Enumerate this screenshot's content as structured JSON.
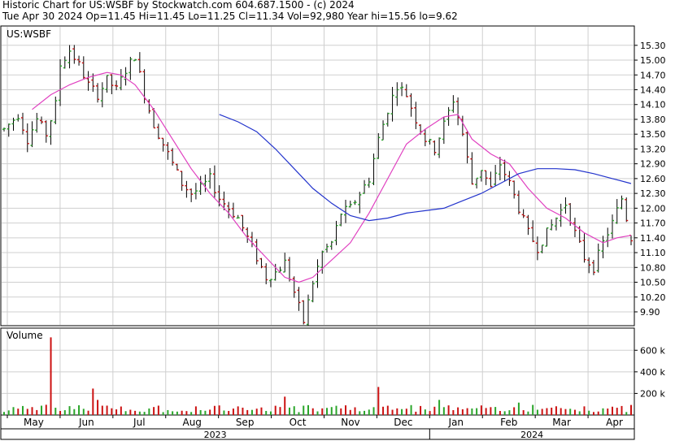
{
  "header": {
    "line1": "Historic Chart for US:WSBF by Stockwatch.com 604.687.1500 - (c) 2024",
    "line2": "Tue Apr 30 2024   Op=11.45   Hi=11.45   Lo=11.25   Cl=11.34   Vol=92,980   Year hi=15.56   lo=9.62"
  },
  "chart_data": {
    "type": "ohlc",
    "symbol_label": "US:WSBF",
    "volume_label": "Volume",
    "price_ticks": [
      15.3,
      15.0,
      14.7,
      14.4,
      14.1,
      13.8,
      13.5,
      13.2,
      12.9,
      12.6,
      12.3,
      12.0,
      11.7,
      11.4,
      11.1,
      10.8,
      10.5,
      10.2,
      9.9
    ],
    "price_tick_labels": [
      "15.30",
      "15.00",
      "14.70",
      "14.40",
      "14.10",
      "13.80",
      "13.50",
      "13.20",
      "12.90",
      "12.60",
      "12.30",
      "12.00",
      "11.70",
      "11.40",
      "11.10",
      "10.80",
      "10.50",
      "10.20",
      "9.90"
    ],
    "price_range": [
      9.62,
      15.56
    ],
    "volume_ticks": [
      200000,
      400000,
      600000
    ],
    "volume_tick_labels": [
      "200 k",
      "400 k",
      "600 k"
    ],
    "volume_range": [
      0,
      760000
    ],
    "months": [
      "May",
      "Jun",
      "Jul",
      "Aug",
      "Sep",
      "Oct",
      "Nov",
      "Dec",
      "Jan",
      "Feb",
      "Mar",
      "Apr"
    ],
    "years": [
      "2023",
      "2024"
    ],
    "last_bar": {
      "open": 11.45,
      "high": 11.45,
      "low": 11.25,
      "close": 11.34,
      "volume": 92980
    },
    "price_path": [
      [
        0,
        13.6
      ],
      [
        3,
        13.9
      ],
      [
        5,
        13.4
      ],
      [
        7,
        13.8
      ],
      [
        9,
        13.5
      ],
      [
        11,
        14.1
      ],
      [
        12,
        14.9
      ],
      [
        14,
        15.2
      ],
      [
        16,
        14.9
      ],
      [
        18,
        14.5
      ],
      [
        20,
        14.3
      ],
      [
        22,
        14.6
      ],
      [
        24,
        14.4
      ],
      [
        26,
        14.8
      ],
      [
        28,
        15.1
      ],
      [
        30,
        14.3
      ],
      [
        32,
        13.7
      ],
      [
        34,
        13.3
      ],
      [
        36,
        12.9
      ],
      [
        38,
        12.5
      ],
      [
        40,
        12.3
      ],
      [
        42,
        12.4
      ],
      [
        44,
        12.6
      ],
      [
        46,
        12.2
      ],
      [
        48,
        12.0
      ],
      [
        50,
        11.8
      ],
      [
        52,
        11.4
      ],
      [
        54,
        11.0
      ],
      [
        56,
        10.6
      ],
      [
        58,
        10.7
      ],
      [
        60,
        10.9
      ],
      [
        62,
        10.3
      ],
      [
        64,
        9.7
      ],
      [
        66,
        10.5
      ],
      [
        68,
        11.1
      ],
      [
        70,
        11.3
      ],
      [
        72,
        11.9
      ],
      [
        74,
        12.0
      ],
      [
        76,
        12.3
      ],
      [
        78,
        12.6
      ],
      [
        80,
        13.4
      ],
      [
        82,
        14.0
      ],
      [
        84,
        14.5
      ],
      [
        86,
        14.3
      ],
      [
        88,
        13.8
      ],
      [
        90,
        13.4
      ],
      [
        92,
        13.2
      ],
      [
        94,
        13.7
      ],
      [
        96,
        14.2
      ],
      [
        98,
        13.5
      ],
      [
        100,
        12.5
      ],
      [
        102,
        12.8
      ],
      [
        104,
        12.4
      ],
      [
        106,
        12.9
      ],
      [
        108,
        12.5
      ],
      [
        110,
        12.0
      ],
      [
        112,
        11.5
      ],
      [
        114,
        11.2
      ],
      [
        116,
        11.5
      ],
      [
        118,
        11.8
      ],
      [
        120,
        12.1
      ],
      [
        122,
        11.5
      ],
      [
        124,
        11.0
      ],
      [
        126,
        10.8
      ],
      [
        128,
        11.3
      ],
      [
        130,
        11.7
      ],
      [
        132,
        12.2
      ],
      [
        134,
        11.4
      ]
    ],
    "ma_short": [
      [
        6,
        14.0
      ],
      [
        10,
        14.3
      ],
      [
        14,
        14.5
      ],
      [
        18,
        14.65
      ],
      [
        22,
        14.75
      ],
      [
        25,
        14.7
      ],
      [
        28,
        14.5
      ],
      [
        32,
        14.0
      ],
      [
        36,
        13.4
      ],
      [
        40,
        12.8
      ],
      [
        44,
        12.3
      ],
      [
        48,
        11.9
      ],
      [
        52,
        11.4
      ],
      [
        56,
        11.0
      ],
      [
        60,
        10.6
      ],
      [
        63,
        10.5
      ],
      [
        66,
        10.6
      ],
      [
        70,
        10.95
      ],
      [
        74,
        11.3
      ],
      [
        78,
        11.9
      ],
      [
        82,
        12.6
      ],
      [
        86,
        13.3
      ],
      [
        90,
        13.6
      ],
      [
        94,
        13.85
      ],
      [
        97,
        13.9
      ],
      [
        100,
        13.4
      ],
      [
        104,
        13.1
      ],
      [
        108,
        12.9
      ],
      [
        112,
        12.4
      ],
      [
        116,
        12.0
      ],
      [
        120,
        11.8
      ],
      [
        124,
        11.5
      ],
      [
        128,
        11.3
      ],
      [
        131,
        11.4
      ],
      [
        134,
        11.45
      ]
    ],
    "ma_long": [
      [
        46,
        13.9
      ],
      [
        50,
        13.75
      ],
      [
        54,
        13.55
      ],
      [
        58,
        13.2
      ],
      [
        62,
        12.8
      ],
      [
        66,
        12.4
      ],
      [
        70,
        12.1
      ],
      [
        74,
        11.85
      ],
      [
        78,
        11.75
      ],
      [
        82,
        11.8
      ],
      [
        86,
        11.9
      ],
      [
        90,
        11.95
      ],
      [
        94,
        12.0
      ],
      [
        98,
        12.15
      ],
      [
        102,
        12.3
      ],
      [
        106,
        12.5
      ],
      [
        110,
        12.7
      ],
      [
        114,
        12.8
      ],
      [
        118,
        12.8
      ],
      [
        122,
        12.78
      ],
      [
        126,
        12.7
      ],
      [
        130,
        12.6
      ],
      [
        134,
        12.5
      ]
    ],
    "volume_spikes": [
      [
        10,
        720000
      ],
      [
        19,
        245000
      ],
      [
        80,
        260000
      ],
      [
        60,
        170000
      ],
      [
        20,
        140000
      ],
      [
        93,
        140000
      ],
      [
        110,
        115000
      ]
    ]
  },
  "colors": {
    "up": "#2aa52a",
    "down": "#cc1111",
    "ma_short": "#e040c0",
    "ma_long": "#2233cc",
    "grid": "#cfcfcf",
    "frame": "#000000"
  }
}
